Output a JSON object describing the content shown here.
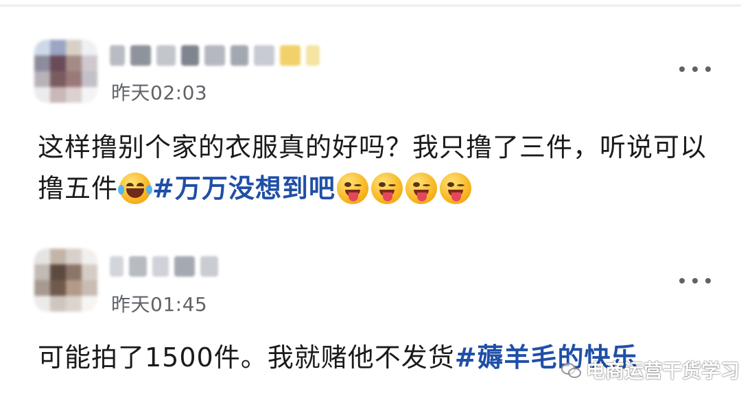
{
  "posts": [
    {
      "time": "昨天02:03",
      "text": "这样撸别个家的衣服真的好吗？我只撸了三件，听说可以撸五件",
      "hashtag": "#万万没想到吧",
      "emojis": [
        "laughing-tears-emoji",
        "winking-tongue-emoji",
        "winking-tongue-emoji",
        "winking-tongue-emoji",
        "winking-tongue-emoji"
      ]
    },
    {
      "time": "昨天01:45",
      "text": "可能拍了1500件。我就赌他不发货",
      "hashtag": "#薅羊毛的快乐"
    }
  ],
  "watermark": "电商运营干货学习",
  "colors": {
    "hashtag": "#1f4fa7",
    "timestamp": "#5f6368",
    "text": "#1a1a1a"
  }
}
